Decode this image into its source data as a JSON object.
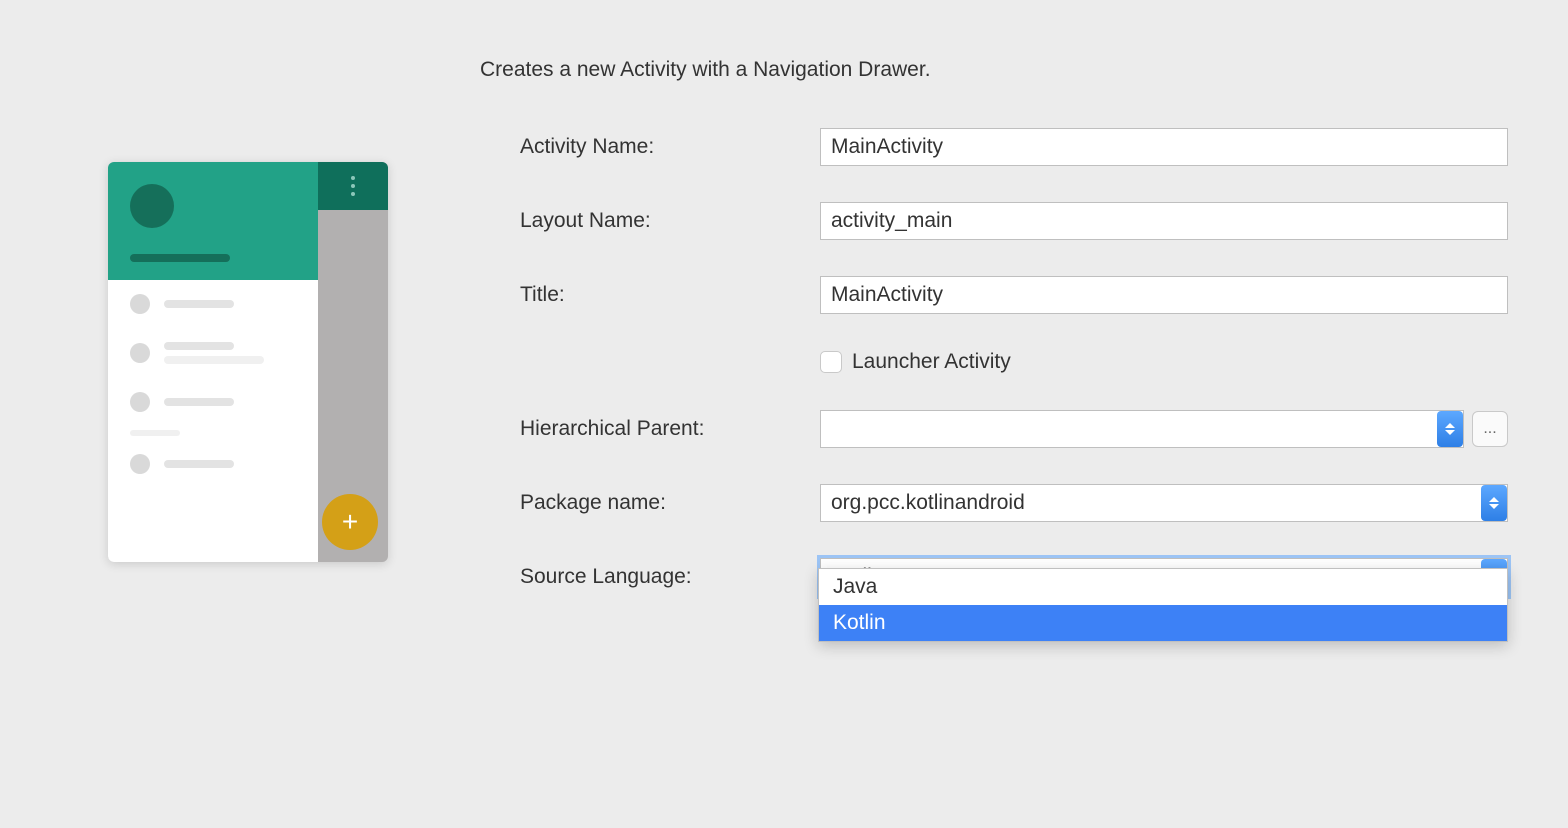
{
  "description": "Creates a new Activity with a Navigation Drawer.",
  "fields": {
    "activityName": {
      "label": "Activity Name:",
      "value": "MainActivity"
    },
    "layoutName": {
      "label": "Layout Name:",
      "value": "activity_main"
    },
    "title": {
      "label": "Title:",
      "value": "MainActivity"
    },
    "launcher": {
      "label": "Launcher Activity",
      "checked": false
    },
    "hierarchicalParent": {
      "label": "Hierarchical Parent:",
      "value": ""
    },
    "packageName": {
      "label": "Package name:",
      "value": "org.pcc.kotlinandroid"
    },
    "sourceLanguage": {
      "label": "Source Language:",
      "value": "Kotlin",
      "options": [
        "Java",
        "Kotlin"
      ],
      "selectedIndex": 1
    }
  },
  "browse": "..."
}
